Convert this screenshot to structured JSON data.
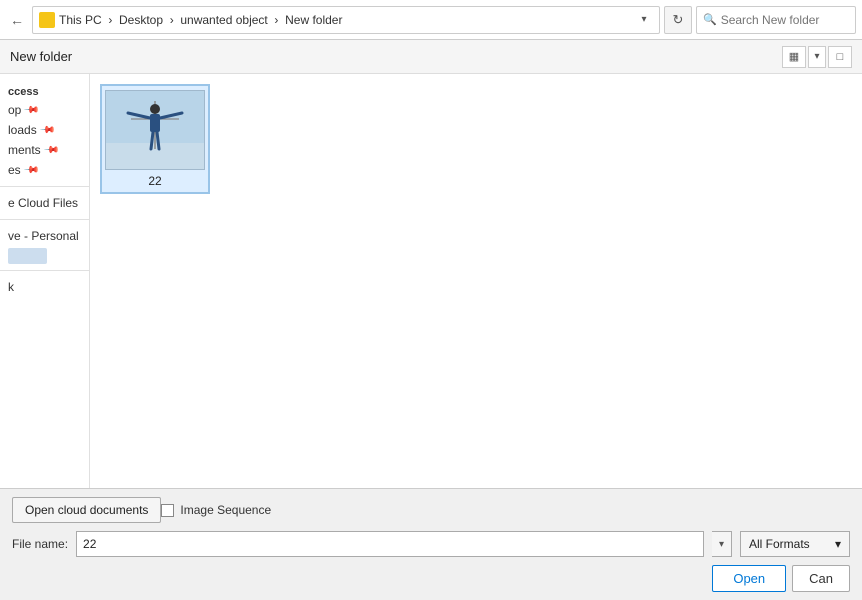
{
  "addressBar": {
    "backArrow": "←",
    "pathIcon": "",
    "pathParts": [
      "This PC",
      "Desktop",
      "unwanted object",
      "New folder"
    ],
    "pathSeparator": " › ",
    "dropdownArrow": "▾",
    "refreshTitle": "↻",
    "searchPlaceholder": "Search New folder"
  },
  "toolbar": {
    "folderTitle": "New folder",
    "viewIcon": "▦",
    "dropdownArrow": "▾",
    "expandIcon": "□"
  },
  "sidebar": {
    "quickAccess": {
      "title": "ccess",
      "items": [
        {
          "label": "op",
          "pinned": true
        },
        {
          "label": "loads",
          "pinned": true
        },
        {
          "label": "ments",
          "pinned": true
        },
        {
          "label": "es",
          "pinned": true
        }
      ]
    },
    "cloudFiles": {
      "label": "e Cloud Files"
    },
    "oneDrive": {
      "label": "ve - Personal",
      "highlight": ""
    },
    "network": {
      "label": "k"
    }
  },
  "files": [
    {
      "id": "22",
      "name": "22",
      "selected": true
    }
  ],
  "bottomBar": {
    "openCloudLabel": "Open cloud documents",
    "imageSequenceLabel": "Image Sequence",
    "fileNameLabel": "File name:",
    "fileNameValue": "22",
    "formatLabel": "All Formats",
    "openLabel": "Open",
    "cancelLabel": "Can"
  }
}
